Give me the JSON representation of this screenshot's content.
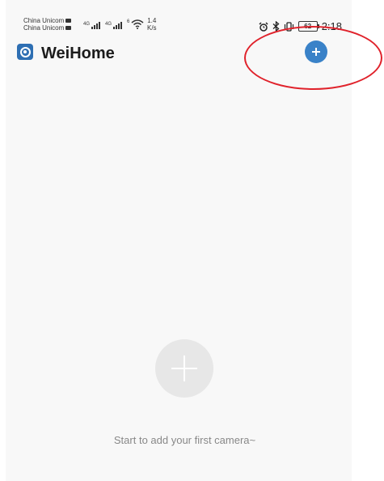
{
  "status_bar": {
    "carrier_1": "China Unicom",
    "carrier_2": "China Unicom",
    "net_1": "4G",
    "net_2": "4G",
    "wifi_gen": "6",
    "speed_value": "1.4",
    "speed_unit": "K/s",
    "battery": "62",
    "time": "2:18",
    "icons": [
      "alarm-icon",
      "bluetooth-icon",
      "vibrate-icon"
    ]
  },
  "app_bar": {
    "title": "WeiHome",
    "logo_icon": "camera-lens-icon",
    "add_icon": "plus-icon",
    "accent": "#3a82c8"
  },
  "annotation": {
    "color": "#e0222b"
  },
  "empty_state": {
    "icon": "plus-icon",
    "message": "Start to add your first camera~"
  }
}
